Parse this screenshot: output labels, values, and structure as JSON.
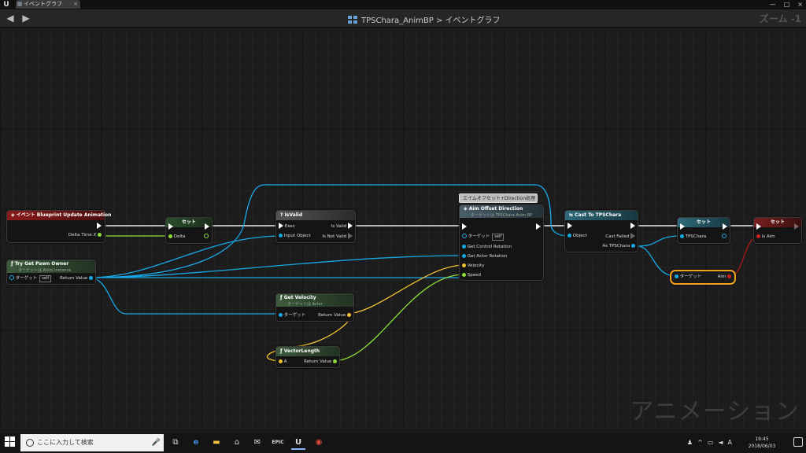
{
  "titlebar": {
    "tab_label": "イベントグラフ",
    "tab_close": "×",
    "min": "—",
    "max": "□",
    "close": "×"
  },
  "toolbar": {
    "back": "◀",
    "forward": "▶",
    "blueprint": "TPSChara_AnimBP",
    "separator": ">",
    "graph": "イベントグラフ",
    "zoom": "ズーム -1"
  },
  "graph": {
    "watermark": "アニメーション",
    "comment": "エイムオフセット+Direction処理",
    "nodes": {
      "event": {
        "title": "イベント Blueprint Update Animation",
        "out_delta": "Delta Time X"
      },
      "set1": {
        "title": "セット",
        "in_delta": "Delta"
      },
      "try_pawn": {
        "title": "Try Get Pawn Owner",
        "subtitle": "ターゲットは Anim Instance",
        "target": "ターゲット",
        "self": "self",
        "ret": "Return Value"
      },
      "isvalid": {
        "title": "IsValid",
        "exec": "Exec",
        "input": "Input Object",
        "is_valid": "Is Valid",
        "is_not_valid": "Is Not Valid"
      },
      "aim": {
        "title": "Aim Offset Direction",
        "subtitle": "ターゲットは TPSChara Anim BP",
        "target": "ターゲット",
        "self": "self",
        "gcr": "Get Control Rotation",
        "gar": "Get Actor Rotation",
        "velocity": "Velocity",
        "speed": "Speed"
      },
      "getvel": {
        "title": "Get Velocity",
        "subtitle": "ターゲットは Actor",
        "target": "ターゲット",
        "ret": "Return Value"
      },
      "veclen": {
        "title": "VectorLength",
        "a": "A",
        "ret": "Return Value"
      },
      "cast": {
        "title": "Cast To TPSChara",
        "object": "Object",
        "failed": "Cast Failed",
        "as": "As TPSChara"
      },
      "set2": {
        "title": "セット",
        "in": "TPSChara"
      },
      "getaim": {
        "target": "ターゲット",
        "aim": "Aim"
      },
      "set3": {
        "title": "セット",
        "in": "Is Aim"
      }
    }
  },
  "taskbar": {
    "search": "ここに入力して検索",
    "time": "19:45",
    "date": "2018/06/03"
  }
}
